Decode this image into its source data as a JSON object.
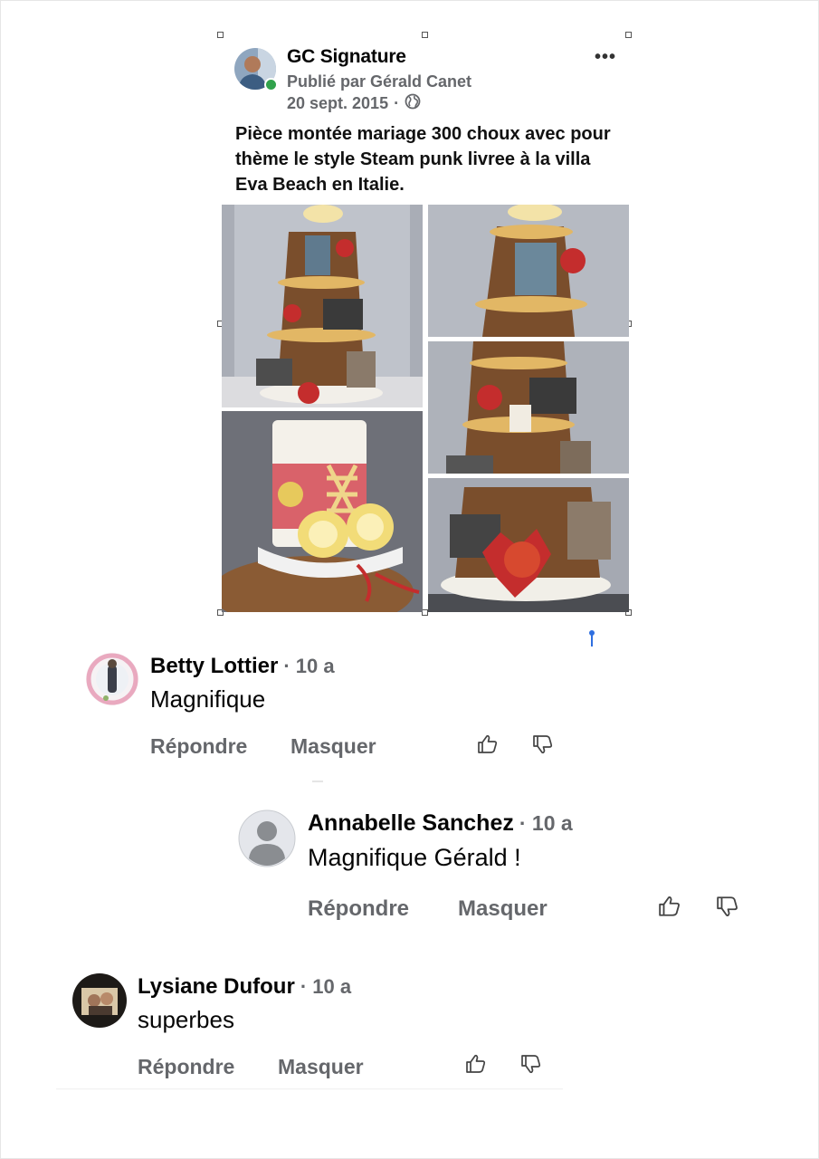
{
  "post": {
    "page_name": "GC Signature",
    "published_by": "Publié par Gérald Canet",
    "date": "20 sept. 2015",
    "date_separator": "·",
    "audience_icon": "globe-icon",
    "more_label": "•••",
    "text": "Pièce montée mariage 300 choux avec pour thème le style Steam punk livree à la villa Eva Beach en Italie."
  },
  "comments": [
    {
      "author": "Betty Lottier",
      "time": "· 10 a",
      "text": "Magnifique",
      "reply_label": "Répondre",
      "hide_label": "Masquer"
    },
    {
      "author": "Annabelle Sanchez",
      "time": "· 10 a",
      "text": "Magnifique Gérald !",
      "reply_label": "Répondre",
      "hide_label": "Masquer"
    },
    {
      "author": "Lysiane Dufour",
      "time": "· 10 a",
      "text": "superbes",
      "reply_label": "Répondre",
      "hide_label": "Masquer"
    }
  ],
  "icons": {
    "like": "thumbs-up-icon",
    "dislike": "thumbs-down-icon"
  },
  "colors": {
    "secondary_text": "#65676b",
    "online": "#31a24c",
    "marker": "#2f6fe0"
  }
}
